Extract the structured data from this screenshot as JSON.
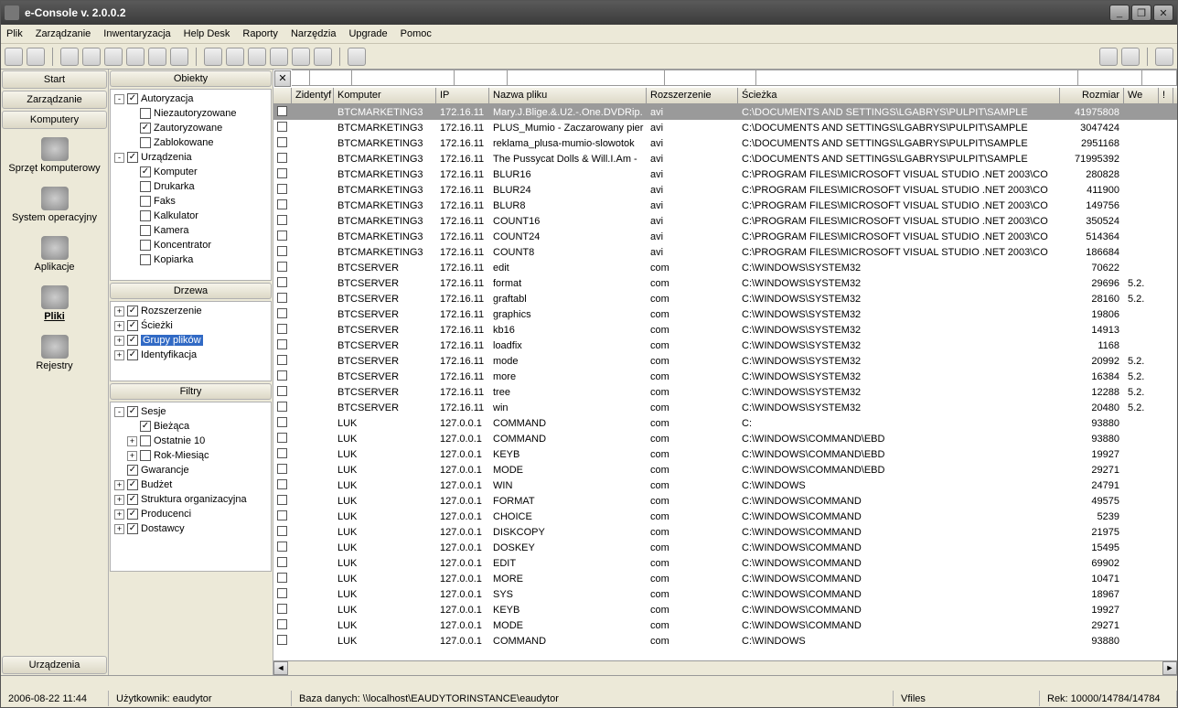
{
  "window": {
    "title": "e-Console v. 2.0.0.2"
  },
  "menu": [
    "Plik",
    "Zarządzanie",
    "Inwentaryzacja",
    "Help Desk",
    "Raporty",
    "Narzędzia",
    "Upgrade",
    "Pomoc"
  ],
  "toolbar": {
    "left_count": 15,
    "right_count": 3
  },
  "nav": {
    "top": [
      "Start",
      "Zarządzanie",
      "Komputery"
    ],
    "items": [
      {
        "label": "Sprzęt komputerowy",
        "sel": false
      },
      {
        "label": "System operacyjny",
        "sel": false
      },
      {
        "label": "Aplikacje",
        "sel": false
      },
      {
        "label": "Pliki",
        "sel": true
      },
      {
        "label": "Rejestry",
        "sel": false
      }
    ],
    "bottom": "Urządzenia"
  },
  "panels": {
    "objects": {
      "title": "Obiekty",
      "tree": [
        {
          "ind": 0,
          "exp": "-",
          "chk": true,
          "label": "Autoryzacja"
        },
        {
          "ind": 1,
          "chk": false,
          "label": "Niezautoryzowane"
        },
        {
          "ind": 1,
          "chk": true,
          "label": "Zautoryzowane"
        },
        {
          "ind": 1,
          "chk": false,
          "label": "Zablokowane"
        },
        {
          "ind": 0,
          "exp": "-",
          "chk": true,
          "label": "Urządzenia"
        },
        {
          "ind": 1,
          "chk": true,
          "label": "Komputer"
        },
        {
          "ind": 1,
          "chk": false,
          "label": "Drukarka"
        },
        {
          "ind": 1,
          "chk": false,
          "label": "Faks"
        },
        {
          "ind": 1,
          "chk": false,
          "label": "Kalkulator"
        },
        {
          "ind": 1,
          "chk": false,
          "label": "Kamera"
        },
        {
          "ind": 1,
          "chk": false,
          "label": "Koncentrator"
        },
        {
          "ind": 1,
          "chk": false,
          "label": "Kopiarka"
        }
      ]
    },
    "trees": {
      "title": "Drzewa",
      "tree": [
        {
          "ind": 0,
          "exp": "+",
          "chk": true,
          "label": "Rozszerzenie"
        },
        {
          "ind": 0,
          "exp": "+",
          "chk": true,
          "label": "Ścieżki"
        },
        {
          "ind": 0,
          "exp": "+",
          "chk": true,
          "label": "Grupy plików",
          "sel": true
        },
        {
          "ind": 0,
          "exp": "+",
          "chk": true,
          "label": "Identyfikacja"
        }
      ]
    },
    "filters": {
      "title": "Filtry",
      "tree": [
        {
          "ind": 0,
          "exp": "-",
          "chk": true,
          "label": "Sesje"
        },
        {
          "ind": 1,
          "exp": "",
          "chk": true,
          "label": "Bieżąca"
        },
        {
          "ind": 1,
          "exp": "+",
          "chk": false,
          "label": "Ostatnie 10"
        },
        {
          "ind": 1,
          "exp": "+",
          "chk": false,
          "label": "Rok-Miesiąc"
        },
        {
          "ind": 0,
          "exp": "",
          "chk": true,
          "label": "Gwarancje"
        },
        {
          "ind": 0,
          "exp": "+",
          "chk": true,
          "label": "Budżet"
        },
        {
          "ind": 0,
          "exp": "+",
          "chk": true,
          "label": "Struktura organizacyjna"
        },
        {
          "ind": 0,
          "exp": "+",
          "chk": true,
          "label": "Producenci"
        },
        {
          "ind": 0,
          "exp": "+",
          "chk": true,
          "label": "Dostawcy"
        }
      ]
    }
  },
  "grid": {
    "columns": [
      {
        "key": "chk",
        "label": "",
        "cls": "col-chk"
      },
      {
        "key": "id",
        "label": "Zidentyf",
        "cls": "col-id"
      },
      {
        "key": "comp",
        "label": "Komputer",
        "cls": "col-comp"
      },
      {
        "key": "ip",
        "label": "IP",
        "cls": "col-ip"
      },
      {
        "key": "fname",
        "label": "Nazwa pliku",
        "cls": "col-fname"
      },
      {
        "key": "ext",
        "label": "Rozszerzenie",
        "cls": "col-ext"
      },
      {
        "key": "path",
        "label": "Ścieżka",
        "cls": "col-path"
      },
      {
        "key": "size",
        "label": "Rozmiar",
        "cls": "col-size num"
      },
      {
        "key": "we",
        "label": "We",
        "cls": "col-we"
      }
    ],
    "rows": [
      {
        "sel": true,
        "comp": "BTCMARKETING3",
        "ip": "172.16.11",
        "fname": "Mary.J.Blige.&.U2.-.One.DVDRip.",
        "ext": "avi",
        "path": "C:\\DOCUMENTS AND SETTINGS\\LGABRYS\\PULPIT\\SAMPLE",
        "size": "41975808",
        "we": ""
      },
      {
        "comp": "BTCMARKETING3",
        "ip": "172.16.11",
        "fname": "PLUS_Mumio - Zaczarowany pier",
        "ext": "avi",
        "path": "C:\\DOCUMENTS AND SETTINGS\\LGABRYS\\PULPIT\\SAMPLE",
        "size": "3047424",
        "we": ""
      },
      {
        "comp": "BTCMARKETING3",
        "ip": "172.16.11",
        "fname": "reklama_plusa-mumio-slowotok",
        "ext": "avi",
        "path": "C:\\DOCUMENTS AND SETTINGS\\LGABRYS\\PULPIT\\SAMPLE",
        "size": "2951168",
        "we": ""
      },
      {
        "comp": "BTCMARKETING3",
        "ip": "172.16.11",
        "fname": "The Pussycat Dolls & Will.I.Am -",
        "ext": "avi",
        "path": "C:\\DOCUMENTS AND SETTINGS\\LGABRYS\\PULPIT\\SAMPLE",
        "size": "71995392",
        "we": ""
      },
      {
        "comp": "BTCMARKETING3",
        "ip": "172.16.11",
        "fname": "BLUR16",
        "ext": "avi",
        "path": "C:\\PROGRAM FILES\\MICROSOFT VISUAL STUDIO .NET 2003\\CO",
        "size": "280828",
        "we": ""
      },
      {
        "comp": "BTCMARKETING3",
        "ip": "172.16.11",
        "fname": "BLUR24",
        "ext": "avi",
        "path": "C:\\PROGRAM FILES\\MICROSOFT VISUAL STUDIO .NET 2003\\CO",
        "size": "411900",
        "we": ""
      },
      {
        "comp": "BTCMARKETING3",
        "ip": "172.16.11",
        "fname": "BLUR8",
        "ext": "avi",
        "path": "C:\\PROGRAM FILES\\MICROSOFT VISUAL STUDIO .NET 2003\\CO",
        "size": "149756",
        "we": ""
      },
      {
        "comp": "BTCMARKETING3",
        "ip": "172.16.11",
        "fname": "COUNT16",
        "ext": "avi",
        "path": "C:\\PROGRAM FILES\\MICROSOFT VISUAL STUDIO .NET 2003\\CO",
        "size": "350524",
        "we": ""
      },
      {
        "comp": "BTCMARKETING3",
        "ip": "172.16.11",
        "fname": "COUNT24",
        "ext": "avi",
        "path": "C:\\PROGRAM FILES\\MICROSOFT VISUAL STUDIO .NET 2003\\CO",
        "size": "514364",
        "we": ""
      },
      {
        "comp": "BTCMARKETING3",
        "ip": "172.16.11",
        "fname": "COUNT8",
        "ext": "avi",
        "path": "C:\\PROGRAM FILES\\MICROSOFT VISUAL STUDIO .NET 2003\\CO",
        "size": "186684",
        "we": ""
      },
      {
        "comp": "BTCSERVER",
        "ip": "172.16.11",
        "fname": "edit",
        "ext": "com",
        "path": "C:\\WINDOWS\\SYSTEM32",
        "size": "70622",
        "we": ""
      },
      {
        "comp": "BTCSERVER",
        "ip": "172.16.11",
        "fname": "format",
        "ext": "com",
        "path": "C:\\WINDOWS\\SYSTEM32",
        "size": "29696",
        "we": "5.2."
      },
      {
        "comp": "BTCSERVER",
        "ip": "172.16.11",
        "fname": "graftabl",
        "ext": "com",
        "path": "C:\\WINDOWS\\SYSTEM32",
        "size": "28160",
        "we": "5.2."
      },
      {
        "comp": "BTCSERVER",
        "ip": "172.16.11",
        "fname": "graphics",
        "ext": "com",
        "path": "C:\\WINDOWS\\SYSTEM32",
        "size": "19806",
        "we": ""
      },
      {
        "comp": "BTCSERVER",
        "ip": "172.16.11",
        "fname": "kb16",
        "ext": "com",
        "path": "C:\\WINDOWS\\SYSTEM32",
        "size": "14913",
        "we": ""
      },
      {
        "comp": "BTCSERVER",
        "ip": "172.16.11",
        "fname": "loadfix",
        "ext": "com",
        "path": "C:\\WINDOWS\\SYSTEM32",
        "size": "1168",
        "we": ""
      },
      {
        "comp": "BTCSERVER",
        "ip": "172.16.11",
        "fname": "mode",
        "ext": "com",
        "path": "C:\\WINDOWS\\SYSTEM32",
        "size": "20992",
        "we": "5.2."
      },
      {
        "comp": "BTCSERVER",
        "ip": "172.16.11",
        "fname": "more",
        "ext": "com",
        "path": "C:\\WINDOWS\\SYSTEM32",
        "size": "16384",
        "we": "5.2."
      },
      {
        "comp": "BTCSERVER",
        "ip": "172.16.11",
        "fname": "tree",
        "ext": "com",
        "path": "C:\\WINDOWS\\SYSTEM32",
        "size": "12288",
        "we": "5.2."
      },
      {
        "comp": "BTCSERVER",
        "ip": "172.16.11",
        "fname": "win",
        "ext": "com",
        "path": "C:\\WINDOWS\\SYSTEM32",
        "size": "20480",
        "we": "5.2."
      },
      {
        "comp": "LUK",
        "ip": "127.0.0.1",
        "fname": "COMMAND",
        "ext": "com",
        "path": "C:",
        "size": "93880",
        "we": ""
      },
      {
        "comp": "LUK",
        "ip": "127.0.0.1",
        "fname": "COMMAND",
        "ext": "com",
        "path": "C:\\WINDOWS\\COMMAND\\EBD",
        "size": "93880",
        "we": ""
      },
      {
        "comp": "LUK",
        "ip": "127.0.0.1",
        "fname": "KEYB",
        "ext": "com",
        "path": "C:\\WINDOWS\\COMMAND\\EBD",
        "size": "19927",
        "we": ""
      },
      {
        "comp": "LUK",
        "ip": "127.0.0.1",
        "fname": "MODE",
        "ext": "com",
        "path": "C:\\WINDOWS\\COMMAND\\EBD",
        "size": "29271",
        "we": ""
      },
      {
        "comp": "LUK",
        "ip": "127.0.0.1",
        "fname": "WIN",
        "ext": "com",
        "path": "C:\\WINDOWS",
        "size": "24791",
        "we": ""
      },
      {
        "comp": "LUK",
        "ip": "127.0.0.1",
        "fname": "FORMAT",
        "ext": "com",
        "path": "C:\\WINDOWS\\COMMAND",
        "size": "49575",
        "we": ""
      },
      {
        "comp": "LUK",
        "ip": "127.0.0.1",
        "fname": "CHOICE",
        "ext": "com",
        "path": "C:\\WINDOWS\\COMMAND",
        "size": "5239",
        "we": ""
      },
      {
        "comp": "LUK",
        "ip": "127.0.0.1",
        "fname": "DISKCOPY",
        "ext": "com",
        "path": "C:\\WINDOWS\\COMMAND",
        "size": "21975",
        "we": ""
      },
      {
        "comp": "LUK",
        "ip": "127.0.0.1",
        "fname": "DOSKEY",
        "ext": "com",
        "path": "C:\\WINDOWS\\COMMAND",
        "size": "15495",
        "we": ""
      },
      {
        "comp": "LUK",
        "ip": "127.0.0.1",
        "fname": "EDIT",
        "ext": "com",
        "path": "C:\\WINDOWS\\COMMAND",
        "size": "69902",
        "we": ""
      },
      {
        "comp": "LUK",
        "ip": "127.0.0.1",
        "fname": "MORE",
        "ext": "com",
        "path": "C:\\WINDOWS\\COMMAND",
        "size": "10471",
        "we": ""
      },
      {
        "comp": "LUK",
        "ip": "127.0.0.1",
        "fname": "SYS",
        "ext": "com",
        "path": "C:\\WINDOWS\\COMMAND",
        "size": "18967",
        "we": ""
      },
      {
        "comp": "LUK",
        "ip": "127.0.0.1",
        "fname": "KEYB",
        "ext": "com",
        "path": "C:\\WINDOWS\\COMMAND",
        "size": "19927",
        "we": ""
      },
      {
        "comp": "LUK",
        "ip": "127.0.0.1",
        "fname": "MODE",
        "ext": "com",
        "path": "C:\\WINDOWS\\COMMAND",
        "size": "29271",
        "we": ""
      },
      {
        "comp": "LUK",
        "ip": "127.0.0.1",
        "fname": "COMMAND",
        "ext": "com",
        "path": "C:\\WINDOWS",
        "size": "93880",
        "we": ""
      }
    ]
  },
  "status": {
    "datetime": "2006-08-22  11:44",
    "user": "Użytkownik: eaudytor",
    "db": "Baza danych: \\\\localhost\\EAUDYTORINSTANCE\\eaudytor",
    "view": "Vfiles",
    "rek": "Rek: 10000/14784/14784"
  }
}
